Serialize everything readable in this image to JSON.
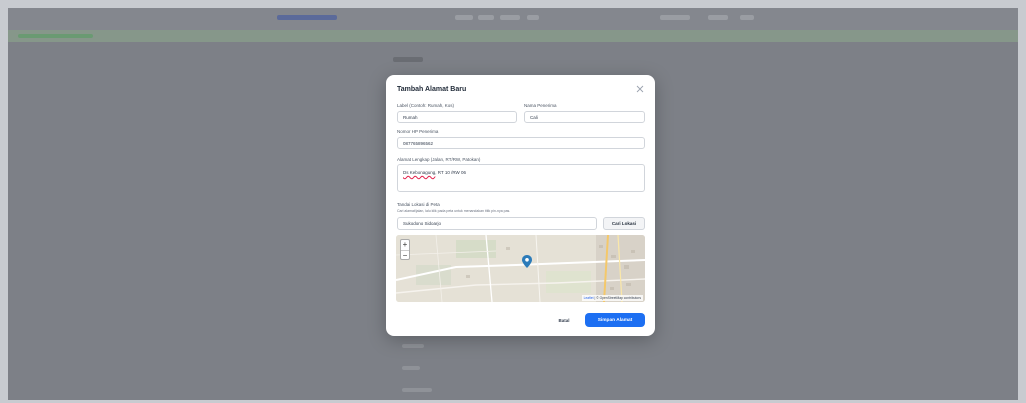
{
  "modal": {
    "title": "Tambah Alamat Baru",
    "label_field": {
      "label": "Label (Contoh: Rumah, Kos)",
      "value": "Rumah"
    },
    "recipient_name": {
      "label": "Nama Penerima",
      "value": "Cali"
    },
    "recipient_phone": {
      "label": "Nomor HP Penerima",
      "value": "087765896562"
    },
    "full_address": {
      "label": "Alamat Lengkap (Jalan, RT/RW, Patokan)",
      "value_word": "Ds Kebonagung",
      "value_rest": ", RT 10 /RW 06"
    },
    "map_section": {
      "label": "Tandai Lokasi di Peta",
      "hint": "Cari alamat/jalan, lalu klik pada peta untuk menandakan titik pin-nya pas.",
      "search_value": "Sukodono Sidoarjo",
      "find_button": "Cari Lokasi",
      "zoom_in": "+",
      "zoom_out": "−",
      "attribution_leaflet": "Leaflet",
      "attribution_rest": " | © OpenStreetMap contributors"
    },
    "cancel_button": "Batal",
    "save_button": "Simpan Alamat",
    "close_icon": "close-icon"
  }
}
